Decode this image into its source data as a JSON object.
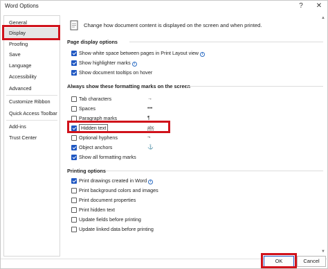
{
  "window": {
    "title": "Word Options",
    "help_label": "?",
    "close_label": "✕"
  },
  "sidebar": {
    "items": [
      {
        "label": "General"
      },
      {
        "label": "Display"
      },
      {
        "label": "Proofing"
      },
      {
        "label": "Save"
      },
      {
        "label": "Language"
      },
      {
        "label": "Accessibility"
      },
      {
        "label": "Advanced"
      },
      {
        "label": "Customize Ribbon"
      },
      {
        "label": "Quick Access Toolbar"
      },
      {
        "label": "Add-ins"
      },
      {
        "label": "Trust Center"
      }
    ],
    "selected": "Display"
  },
  "main": {
    "description": "Change how document content is displayed on the screen and when printed.",
    "page_display": {
      "title": "Page display options",
      "options": [
        {
          "label": "Show white space between pages in Print Layout view",
          "checked": true,
          "info": true
        },
        {
          "label": "Show highlighter marks",
          "checked": true,
          "info": true
        },
        {
          "label": "Show document tooltips on hover",
          "checked": true,
          "info": false
        }
      ]
    },
    "formatting_marks": {
      "title": "Always show these formatting marks on the screen",
      "options": [
        {
          "label": "Tab characters",
          "checked": false,
          "symbol": "→"
        },
        {
          "label": "Spaces",
          "checked": false,
          "symbol": "•••"
        },
        {
          "label": "Paragraph marks",
          "checked": false,
          "symbol": "¶"
        },
        {
          "label": "Hidden text",
          "checked": true,
          "symbol": "abc"
        },
        {
          "label": "Optional hyphens",
          "checked": false,
          "symbol": "¬"
        },
        {
          "label": "Object anchors",
          "checked": true,
          "symbol": "⚓"
        },
        {
          "label": "Show all formatting marks",
          "checked": true,
          "symbol": ""
        }
      ]
    },
    "printing": {
      "title": "Printing options",
      "options": [
        {
          "label": "Print drawings created in Word",
          "checked": true,
          "info": true
        },
        {
          "label": "Print background colors and images",
          "checked": false,
          "info": false
        },
        {
          "label": "Print document properties",
          "checked": false,
          "info": false
        },
        {
          "label": "Print hidden text",
          "checked": false,
          "info": false
        },
        {
          "label": "Update fields before printing",
          "checked": false,
          "info": false
        },
        {
          "label": "Update linked data before printing",
          "checked": false,
          "info": false
        }
      ]
    }
  },
  "footer": {
    "ok_label": "OK",
    "cancel_label": "Cancel"
  },
  "colors": {
    "highlight": "#d0121b",
    "checkbox_checked": "#1f57c2",
    "info_icon": "#2b6cc4"
  }
}
